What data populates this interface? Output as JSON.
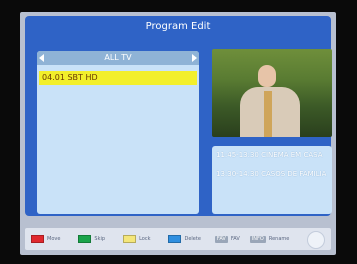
{
  "title": "Program Edit",
  "list": {
    "header": "ALL TV",
    "items": [
      {
        "label": "04.01  SBT HD",
        "selected": true
      }
    ]
  },
  "info": {
    "now": "11:45-13:30  CINEMA EM CASA",
    "next": "13:30-14:30  CASOS DE FAMILIA"
  },
  "footer": {
    "keys": [
      {
        "label": "Move",
        "color": "#e0282e"
      },
      {
        "label": "Skip",
        "color": "#1aa44b"
      },
      {
        "label": "Lock",
        "color": "#f4e67a"
      },
      {
        "label": "Delete",
        "color": "#2f8fe0"
      }
    ],
    "fav_badge": "FAV",
    "fav_label": "FAV",
    "rename_badge": "INFO",
    "rename_label": "Rename"
  }
}
